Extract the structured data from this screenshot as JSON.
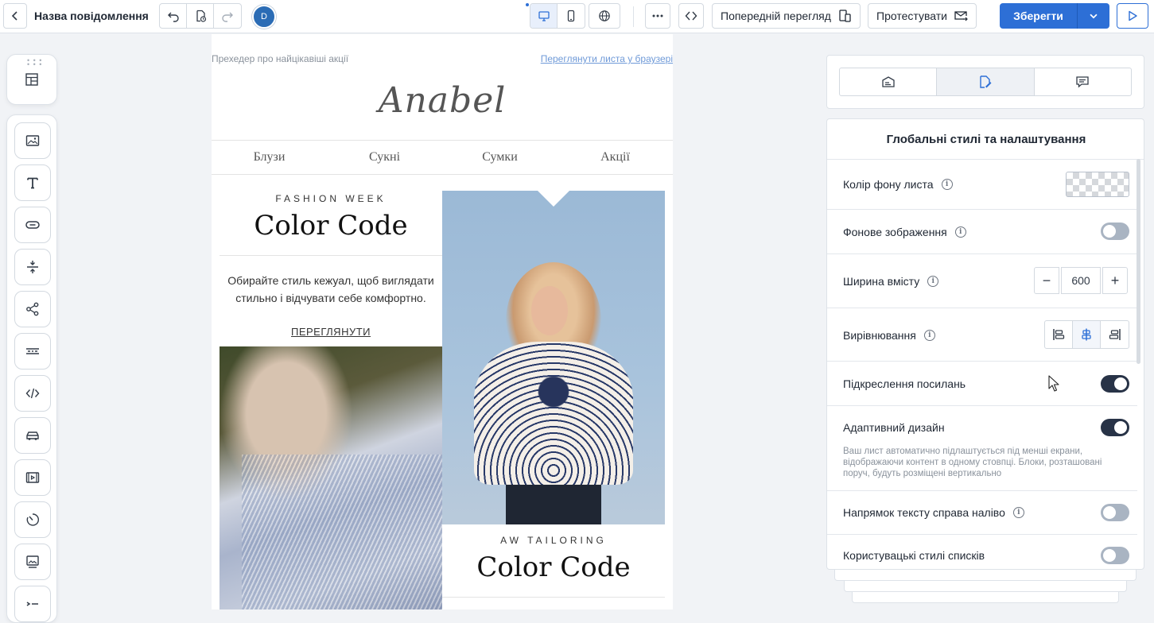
{
  "header": {
    "message_name": "Назва повідомлення",
    "avatar_initial": "D",
    "preview_label": "Попередній перегляд",
    "test_label": "Протестувати",
    "save_label": "Зберегти"
  },
  "email": {
    "preheader": "Прехедер про найцікавіші акції",
    "browser_link": "Переглянути листа у браузері",
    "logo": "Anabel",
    "nav": [
      "Блузи",
      "Сукні",
      "Сумки",
      "Акції"
    ],
    "block1": {
      "eyebrow": "FASHION WEEK",
      "title": "Color Code",
      "text": "Обирайте стиль кежуал, щоб виглядати стильно і відчувати себе комфортно.",
      "link": "ПЕРЕГЛЯНУТИ"
    },
    "block2": {
      "eyebrow": "AW TAILORING",
      "title": "Color Code"
    }
  },
  "panel": {
    "title": "Глобальні стилі та налаштування",
    "rows": {
      "bg_color": "Колір фону листа",
      "bg_image": "Фонове зображення",
      "content_width": "Ширина вмісту",
      "alignment": "Вирівнювання",
      "link_underline": "Підкреслення посилань",
      "responsive": "Адаптивний дизайн",
      "responsive_hint": "Ваш лист автоматично підлаштується під менші екрани, відображаючи контент в одному стовпці. Блоки, розташовані поруч, будуть розміщені вертикально",
      "rtl": "Напрямок тексту справа наліво",
      "list_styles": "Користувацькі стилі списків"
    },
    "width_value": "600",
    "toggles": {
      "bg_image": false,
      "link_underline": true,
      "responsive": true,
      "rtl": false,
      "list_styles": false
    }
  },
  "colors": {
    "accent": "#2d6fd6",
    "toggle_on": "#283347",
    "toggle_off": "#a9b4c2"
  }
}
